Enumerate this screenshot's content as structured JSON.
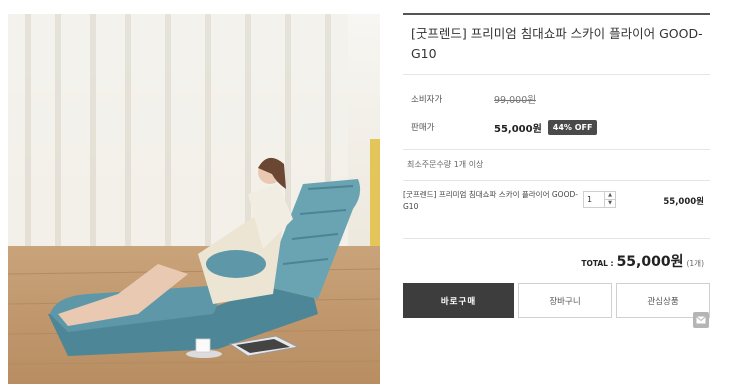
{
  "product": {
    "title": "[굿프렌드] 프리미엄 침대쇼파 스카이 플라이어 GOOD-G10",
    "image_alt": "product-photo"
  },
  "price": {
    "consumer_label": "소비자가",
    "consumer_price": "99,000원",
    "sale_label": "판매가",
    "sale_price": "55,000원",
    "discount": "44% OFF"
  },
  "min_order": "최소주문수량 1개 이상",
  "option": {
    "name": "[굿프렌드] 프리미엄 침대쇼파 스카이 플라이어 GOOD-G10",
    "quantity": "1",
    "qty_up": "▲",
    "qty_down": "▼",
    "price": "55,000원"
  },
  "total": {
    "label": "TOTAL :",
    "amount": "55,000원",
    "count": "(1개)"
  },
  "buttons": {
    "buy": "바로구매",
    "cart": "장바구니",
    "wish": "관심상품"
  },
  "icons": {
    "share": "mail-icon"
  },
  "colors": {
    "buy_button": "#3d3d3d",
    "discount_badge": "#4a4a4a",
    "sofa": "#5e98a8"
  }
}
